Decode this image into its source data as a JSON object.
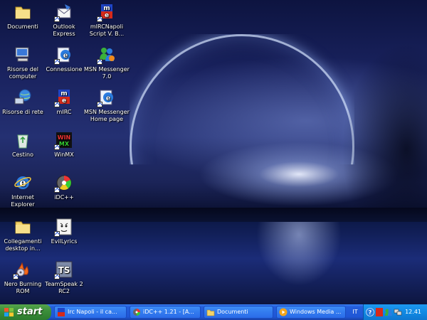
{
  "desktop": {
    "icons": [
      {
        "name": "documenti-icon",
        "label": "Documenti"
      },
      {
        "name": "outlook-express-icon",
        "label": "Outlook\nExpress"
      },
      {
        "name": "mircnapoli-icon",
        "label": "mIRCNapoli\nScript V. B..."
      },
      {
        "name": "risorse-computer-icon",
        "label": "Risorse del\ncomputer"
      },
      {
        "name": "connessione-icon",
        "label": "Connessione"
      },
      {
        "name": "msn-messenger-icon",
        "label": "MSN Messenger\n7.0"
      },
      {
        "name": "risorse-rete-icon",
        "label": "Risorse di rete"
      },
      {
        "name": "mirc-icon",
        "label": "mIRC"
      },
      {
        "name": "msn-homepage-icon",
        "label": "MSN Messenger\nHome page"
      },
      {
        "name": "cestino-icon",
        "label": "Cestino"
      },
      {
        "name": "winmx-icon",
        "label": "WinMX"
      },
      {
        "name": "internet-explorer-icon",
        "label": "Internet\nExplorer"
      },
      {
        "name": "idcpp-icon",
        "label": "iDC++"
      },
      {
        "name": "collegamenti-icon",
        "label": "Collegamenti\ndesktop in..."
      },
      {
        "name": "evillyrics-icon",
        "label": "EvilLyrics"
      },
      {
        "name": "nero-icon",
        "label": "Nero Burning\nROM"
      },
      {
        "name": "teamspeak-icon",
        "label": "TeamSpeak 2\nRC2"
      }
    ]
  },
  "taskbar": {
    "start_label": "start",
    "tasks": [
      {
        "label": "Irc Napoli - il ca..."
      },
      {
        "label": "iDC++ 1.21 - [A..."
      },
      {
        "label": "Documenti"
      },
      {
        "label": "Windows Media ..."
      }
    ],
    "language": "IT",
    "clock": "12.41"
  }
}
